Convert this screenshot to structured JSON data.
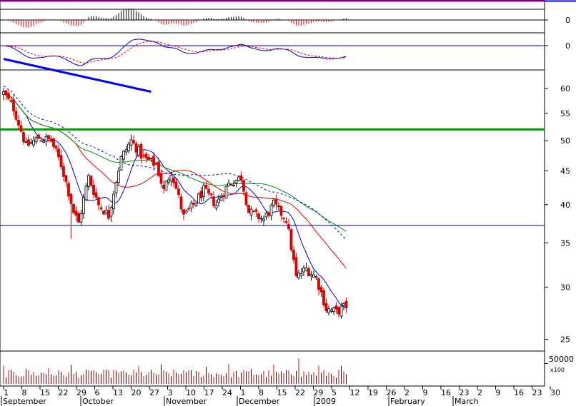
{
  "chart_data": {
    "type": "candlestick",
    "price_axis": {
      "scale": "log",
      "ticks": [
        25,
        30,
        35,
        40,
        45,
        50,
        55,
        60
      ],
      "ylim": [
        24,
        64
      ]
    },
    "macd_axis_tick": "0",
    "histogram_axis_tick": "0",
    "volume_axis": {
      "tick": "50000",
      "multiplier_label": "x100",
      "max": 70000
    },
    "x_ticks": [
      "1",
      "8",
      "15",
      "22",
      "29",
      "6",
      "13",
      "20",
      "27",
      "3",
      "10",
      "17",
      "24",
      "1",
      "8",
      "15",
      "22",
      "29",
      "5",
      "12",
      "19",
      "26",
      "2",
      "9",
      "16",
      "23",
      "2",
      "9",
      "16",
      "23",
      "30"
    ],
    "months": [
      "September",
      "October",
      "November",
      "December",
      "2009",
      "February",
      "March"
    ],
    "reference_lines": [
      {
        "price": 52.0,
        "color": "#00a000"
      },
      {
        "price": 37.2,
        "color": "#0000c8"
      }
    ],
    "trendline": {
      "x_days": [
        0,
        59
      ],
      "prices": [
        66.5,
        59.3
      ],
      "color": "#0000ff"
    },
    "candles": [],
    "volume": []
  },
  "colors": {
    "up": "#000000",
    "down": "#e00000",
    "ma_red": "#e00000",
    "ma_blue": "#0000c8",
    "ma_green": "#009000",
    "frame": "#000000",
    "top_rule": "#b000b0",
    "right_rule": "#0000ff"
  }
}
